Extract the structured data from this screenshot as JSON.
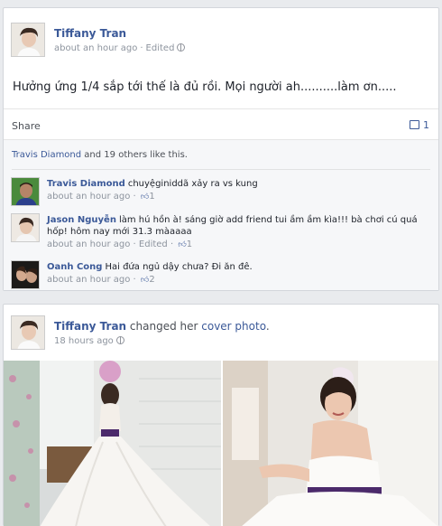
{
  "post1": {
    "author": "Tiffany Tran",
    "time": "about an hour ago",
    "edited": "Edited",
    "status": "Hưởng ứng 1/4 sắp tới thế là đủ rồi. Mọi người ah..........làm ơn.....",
    "share_label": "Share",
    "comment_count": "1",
    "likes_text": " and 19 others like this.",
    "likes_name": "Travis Diamond",
    "comments": [
      {
        "author": "Travis Diamond",
        "text": "chuyệginiddã xảy ra vs kung",
        "time": "about an hour ago",
        "likes": "1"
      },
      {
        "author": "Jason Nguyễn",
        "text": "làm hú hồn à! sáng giờ add friend tui ầm ầm kìa!!! bà chơi cú quá hốp! hôm nay mới 31.3 màaaaa",
        "time": "about an hour ago",
        "edited": "Edited",
        "likes": "1"
      },
      {
        "author": "Oanh Cong",
        "text": "Hai đứa ngủ dậy chưa? Đi ăn đê.",
        "time": "about an hour ago",
        "likes": "2"
      }
    ]
  },
  "post2": {
    "author": "Tiffany Tran",
    "action_pre": " changed her ",
    "action_link": "cover photo",
    "action_post": ".",
    "time": "18 hours ago"
  },
  "icons": {
    "globe": "globe-icon",
    "comment": "comment-icon",
    "like": "thumbs-up-icon"
  },
  "colors": {
    "link": "#3b5998",
    "meta": "#8d949e",
    "feedback_bg": "#f6f7f9"
  }
}
